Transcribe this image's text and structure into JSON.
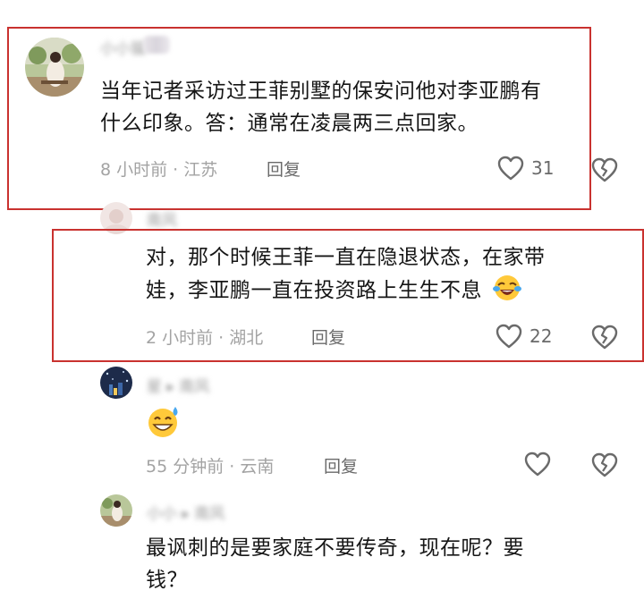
{
  "comments": [
    {
      "username": "小小猫",
      "text_line1": "当年记者采访过王菲别墅的保安问他对李亚鹏有",
      "text_line2": "什么印象。答：通常在凌晨两三点回家。",
      "meta": "8 小时前 · 江苏",
      "reply_label": "回复",
      "likes": "31"
    },
    {
      "username": "南风",
      "text_line1": "对，那个时候王菲一直在隐退状态，在家带",
      "text_line2": "娃，李亚鹏一直在投资路上生生不息",
      "meta": "2 小时前 · 湖北",
      "reply_label": "回复",
      "likes": "22"
    },
    {
      "username": "星 ▸ 南风",
      "meta": "55 分钟前 · 云南",
      "reply_label": "回复",
      "likes": ""
    },
    {
      "username": "小小 ▸ 南风",
      "text_line1": "最讽刺的是要家庭不要传奇，现在呢？要",
      "text_line2": "钱？"
    }
  ],
  "colors": {
    "highlight": "#c9322f",
    "meta": "#a3a3a3",
    "icon": "#6a6a6a"
  },
  "icons": [
    "heart-icon",
    "broken-heart-icon",
    "laughing-crying-emoji",
    "sweat-smile-emoji"
  ]
}
